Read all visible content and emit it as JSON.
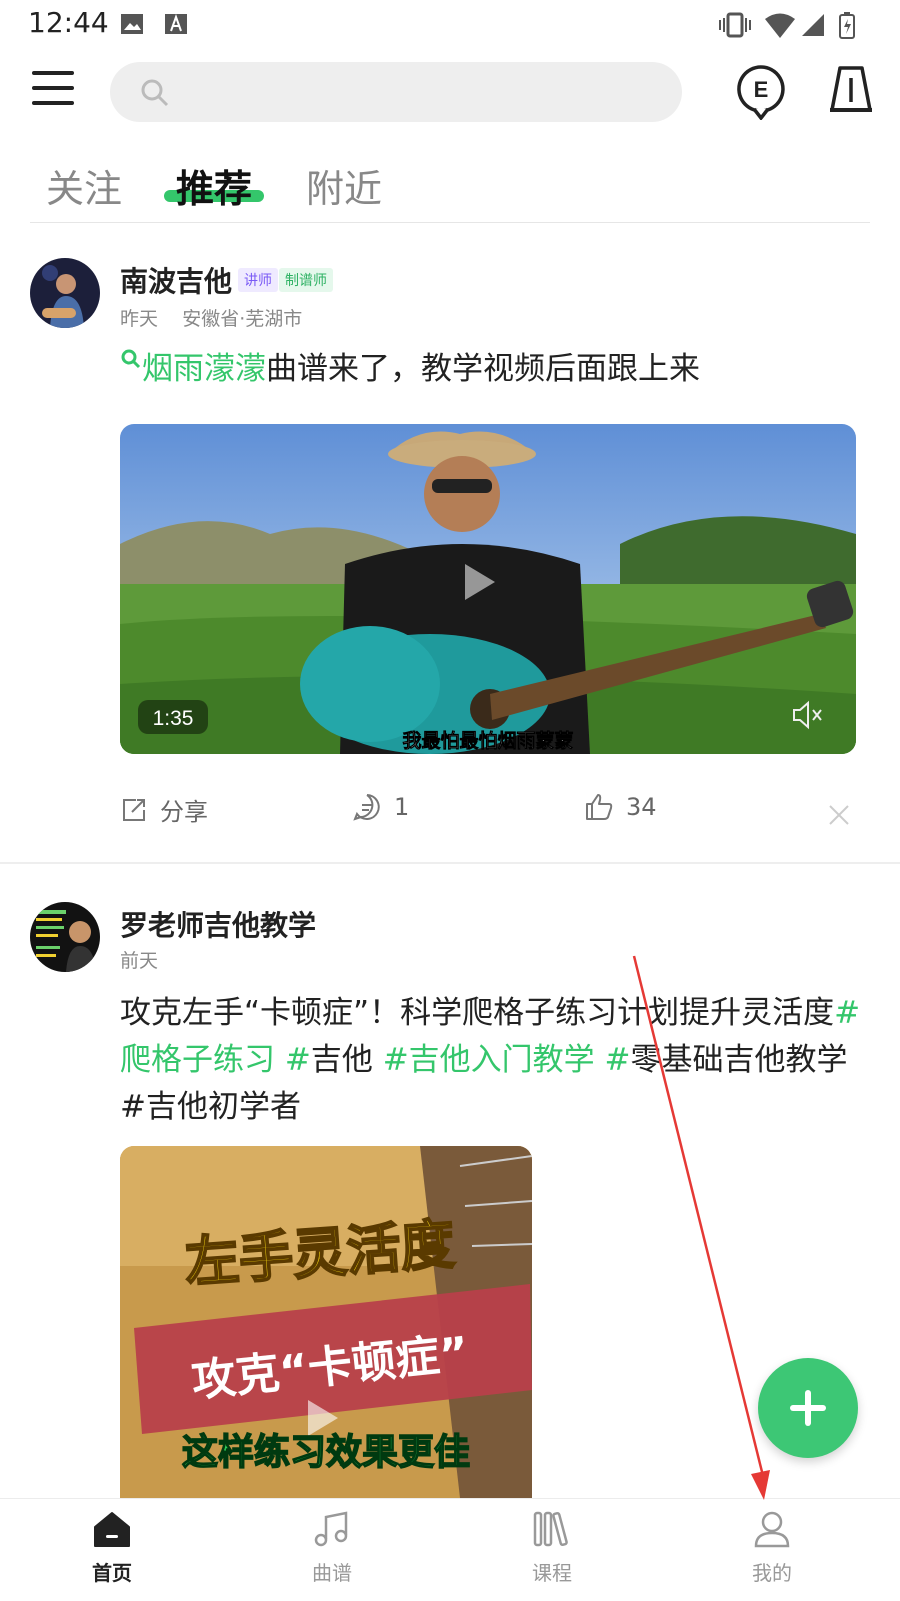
{
  "status_bar": {
    "time": "12:44"
  },
  "search": {
    "placeholder": ""
  },
  "tabs": [
    {
      "label": "关注",
      "active": false
    },
    {
      "label": "推荐",
      "active": true
    },
    {
      "label": "附近",
      "active": false
    }
  ],
  "posts": [
    {
      "author": "南波吉他",
      "badges": [
        "讲师",
        "制谱师"
      ],
      "time": "昨天",
      "location": "安徽省·芜湖市",
      "text_link": "烟雨濛濛",
      "text_rest": "曲谱来了，教学视频后面跟上来",
      "video_duration": "1:35",
      "video_subtitle": "我最怕最怕烟雨蒙蒙",
      "share_label": "分享",
      "comments": "1",
      "likes": "34"
    },
    {
      "author": "罗老师吉他教学",
      "time": "前天",
      "text": {
        "p1": "攻克左手“卡顿症”！科学爬格子练习计划提升灵活度",
        "t1": "#爬格子练习 #",
        "p2": "吉他 ",
        "t2": "#吉他入门教学 #",
        "p3": "零基础吉他教学 #吉他初学者"
      },
      "thumb_line1": "左手灵活度",
      "thumb_line2": "攻克“卡顿症”",
      "thumb_line3": "这样练习效果更佳"
    }
  ],
  "bottom_nav": [
    {
      "label": "首页",
      "active": true,
      "icon": "home-icon"
    },
    {
      "label": "曲谱",
      "active": false,
      "icon": "music-note-icon"
    },
    {
      "label": "课程",
      "active": false,
      "icon": "course-icon"
    },
    {
      "label": "我的",
      "active": false,
      "icon": "profile-icon"
    }
  ],
  "colors": {
    "accent": "#34c66b",
    "annotation": "#e53935"
  }
}
